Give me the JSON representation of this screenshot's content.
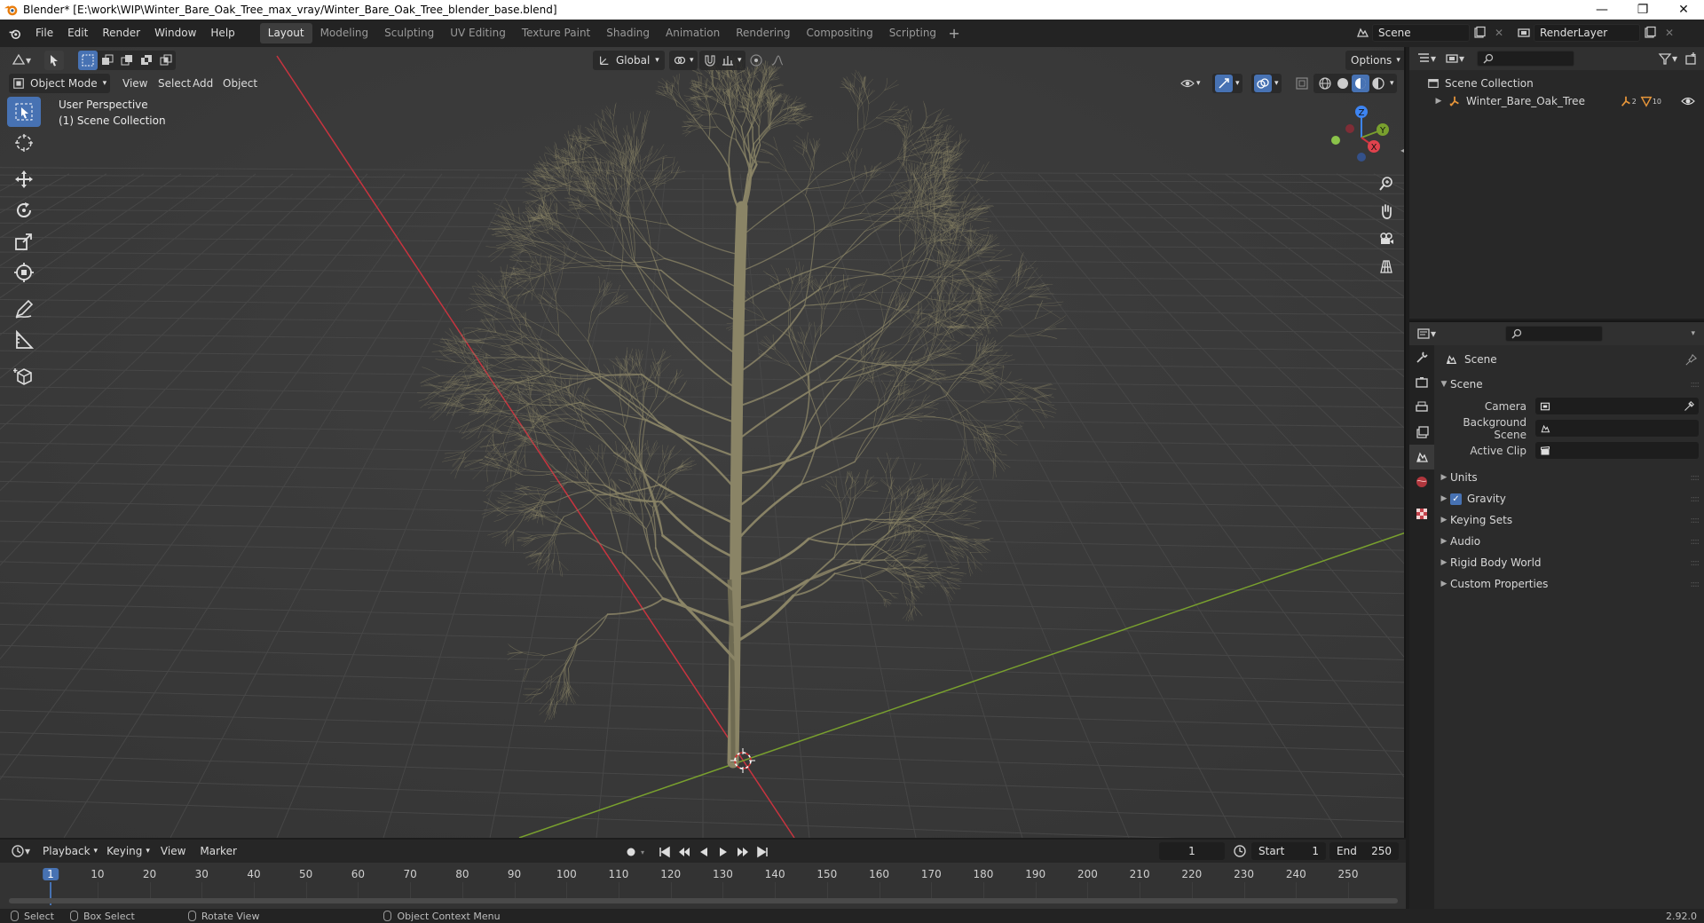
{
  "window": {
    "title": "Blender* [E:\\work\\WIP\\Winter_Bare_Oak_Tree_max_vray/Winter_Bare_Oak_Tree_blender_base.blend]"
  },
  "menu": [
    "File",
    "Edit",
    "Render",
    "Window",
    "Help"
  ],
  "workspaces": [
    "Layout",
    "Modeling",
    "Sculpting",
    "UV Editing",
    "Texture Paint",
    "Shading",
    "Animation",
    "Rendering",
    "Compositing",
    "Scripting"
  ],
  "active_workspace": "Layout",
  "scene_selector": {
    "value": "Scene"
  },
  "view_layer": {
    "value": "RenderLayer"
  },
  "viewport": {
    "mode": "Object Mode",
    "menus": [
      "View",
      "Select",
      "Add",
      "Object"
    ],
    "orientation": "Global",
    "options_label": "Options",
    "info_line1": "User Perspective",
    "info_line2": "(1) Scene Collection",
    "axis_labels": {
      "x": "X",
      "y": "Y",
      "z": "Z"
    }
  },
  "timeline": {
    "menus": [
      "Playback",
      "Keying",
      "View",
      "Marker"
    ],
    "current_frame": "1",
    "start_label": "Start",
    "start": "1",
    "end_label": "End",
    "end": "250",
    "ruler_ticks": [
      "1",
      "10",
      "20",
      "30",
      "40",
      "50",
      "60",
      "70",
      "80",
      "90",
      "100",
      "110",
      "120",
      "130",
      "140",
      "150",
      "160",
      "170",
      "180",
      "190",
      "200",
      "210",
      "220",
      "230",
      "240",
      "250"
    ]
  },
  "outliner": {
    "root": "Scene Collection",
    "items": [
      {
        "name": "Winter_Bare_Oak_Tree",
        "badge_count": "10",
        "badge_small": "2"
      }
    ]
  },
  "properties": {
    "context_title": "Scene",
    "panel_title": "Scene",
    "fields": [
      {
        "label": "Camera",
        "value": ""
      },
      {
        "label": "Background Scene",
        "value": ""
      },
      {
        "label": "Active Clip",
        "value": ""
      }
    ],
    "subpanels": [
      "Units",
      "Gravity",
      "Keying Sets",
      "Audio",
      "Rigid Body World",
      "Custom Properties"
    ],
    "gravity_checked": true
  },
  "statusbar": {
    "items": [
      "Select",
      "Box Select",
      "Rotate View",
      "Object Context Menu"
    ],
    "version": "2.92.0"
  },
  "colors": {
    "accent": "#4772b3",
    "x_axis": "#c8343f",
    "y_axis": "#79a02e",
    "z_axis": "#3d84f2",
    "tree": "#8a8466"
  }
}
